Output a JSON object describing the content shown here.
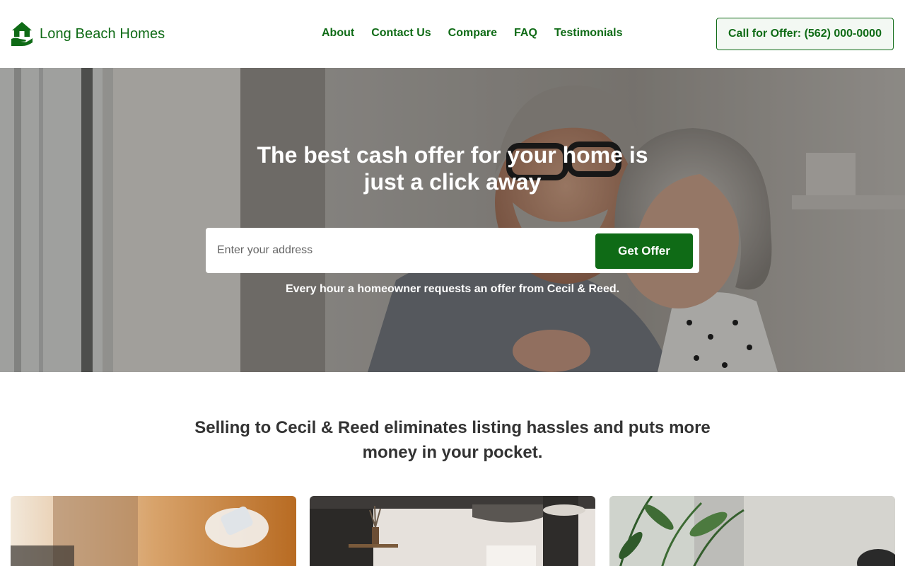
{
  "header": {
    "brand_name": "Long Beach Homes",
    "brand_icon": "house-hand-icon",
    "nav": [
      {
        "label": "About"
      },
      {
        "label": "Contact Us"
      },
      {
        "label": "Compare"
      },
      {
        "label": "FAQ"
      },
      {
        "label": "Testimonials"
      }
    ],
    "call_button": "Call for Offer: (562) 000-0000"
  },
  "hero": {
    "title": "The best cash offer for your home is just a click away",
    "search_placeholder": "Enter your address",
    "search_value": "",
    "submit_label": "Get Offer",
    "subtitle": "Every hour a homeowner requests an offer from Cecil & Reed."
  },
  "section": {
    "title": "Selling to Cecil & Reed eliminates listing hassles and puts more money in your pocket."
  },
  "cards": [
    {
      "image": "hand-holding-phone-photo"
    },
    {
      "image": "kitchen-interior-photo"
    },
    {
      "image": "plants-interior-photo"
    }
  ],
  "colors": {
    "brand_green": "#0f6b16",
    "text_dark": "#333333",
    "white": "#ffffff"
  }
}
